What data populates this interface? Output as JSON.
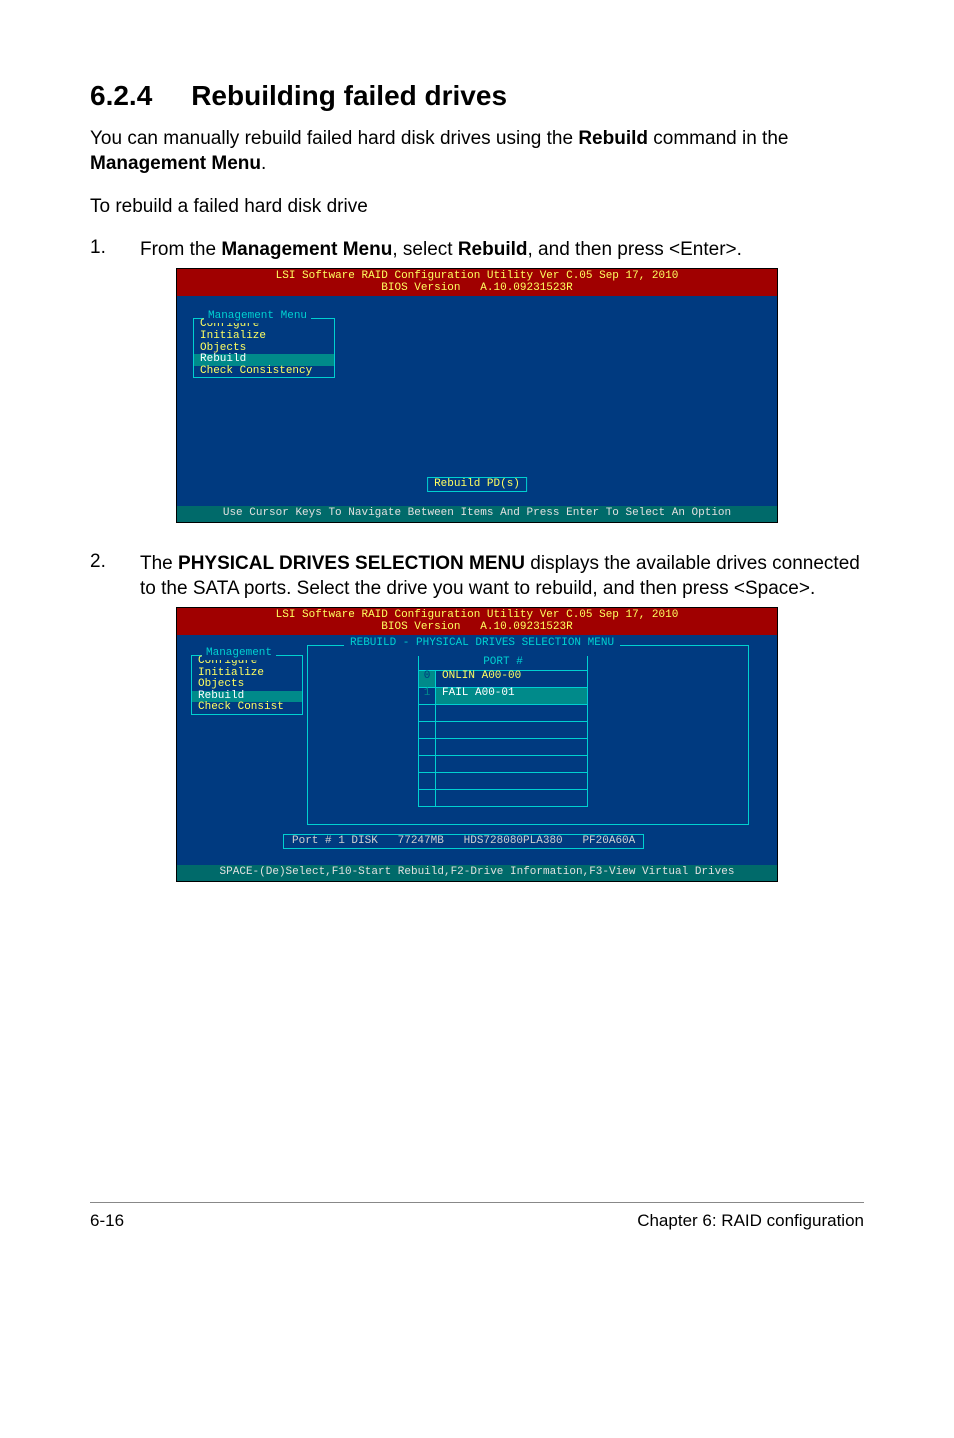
{
  "section": {
    "number": "6.2.4",
    "title": "Rebuilding failed drives"
  },
  "intro": {
    "p1_pre": "You can manually rebuild failed hard disk drives using the ",
    "p1_bold1": "Rebuild",
    "p1_mid": " command in the ",
    "p1_bold2": "Management Menu",
    "p1_post": ".",
    "p2": "To rebuild a failed hard disk drive"
  },
  "step1": {
    "num": "1.",
    "t1": "From the ",
    "b1": "Management Menu",
    "t2": ", select ",
    "b2": "Rebuild",
    "t3": ", and then press <Enter>."
  },
  "bios_common": {
    "header_l1": "LSI Software RAID Configuration Utility Ver C.05 Sep 17, 2010",
    "header_l2": "BIOS Version   A.10.09231523R"
  },
  "bios1": {
    "menu_title": "Management Menu",
    "items": [
      "Configure",
      "Initialize",
      "Objects",
      "Rebuild",
      "Check Consistency"
    ],
    "selected_index": 3,
    "tooltip": "Rebuild PD(s)",
    "footer": "Use Cursor Keys To Navigate Between Items And Press Enter To Select An Option"
  },
  "step2": {
    "num": "2.",
    "t1": "The ",
    "b1": "PHYSICAL DRIVES SELECTION MENU",
    "t2": " displays the available drives connected to the SATA ports. Select the drive you want to rebuild, and then press <Space>."
  },
  "bios2": {
    "menu_title": "Management",
    "items": [
      "Configure",
      "Initialize",
      "Objects",
      "Rebuild",
      "Check Consist"
    ],
    "selected_index": 3,
    "panel_title": "REBUILD - PHYSICAL DRIVES SELECTION MENU",
    "port_header": "PORT #",
    "rows": [
      {
        "idx": "0",
        "val": "ONLIN A00-00",
        "selected": false
      },
      {
        "idx": "1",
        "val": "FAIL  A00-01",
        "selected": true
      }
    ],
    "info_bar": "Port # 1 DISK   77247MB   HDS728080PLA380   PF20A60A",
    "footer": "SPACE-(De)Select,F10-Start Rebuild,F2-Drive Information,F3-View Virtual Drives"
  },
  "footer": {
    "left": "6-16",
    "right": "Chapter 6: RAID configuration"
  }
}
